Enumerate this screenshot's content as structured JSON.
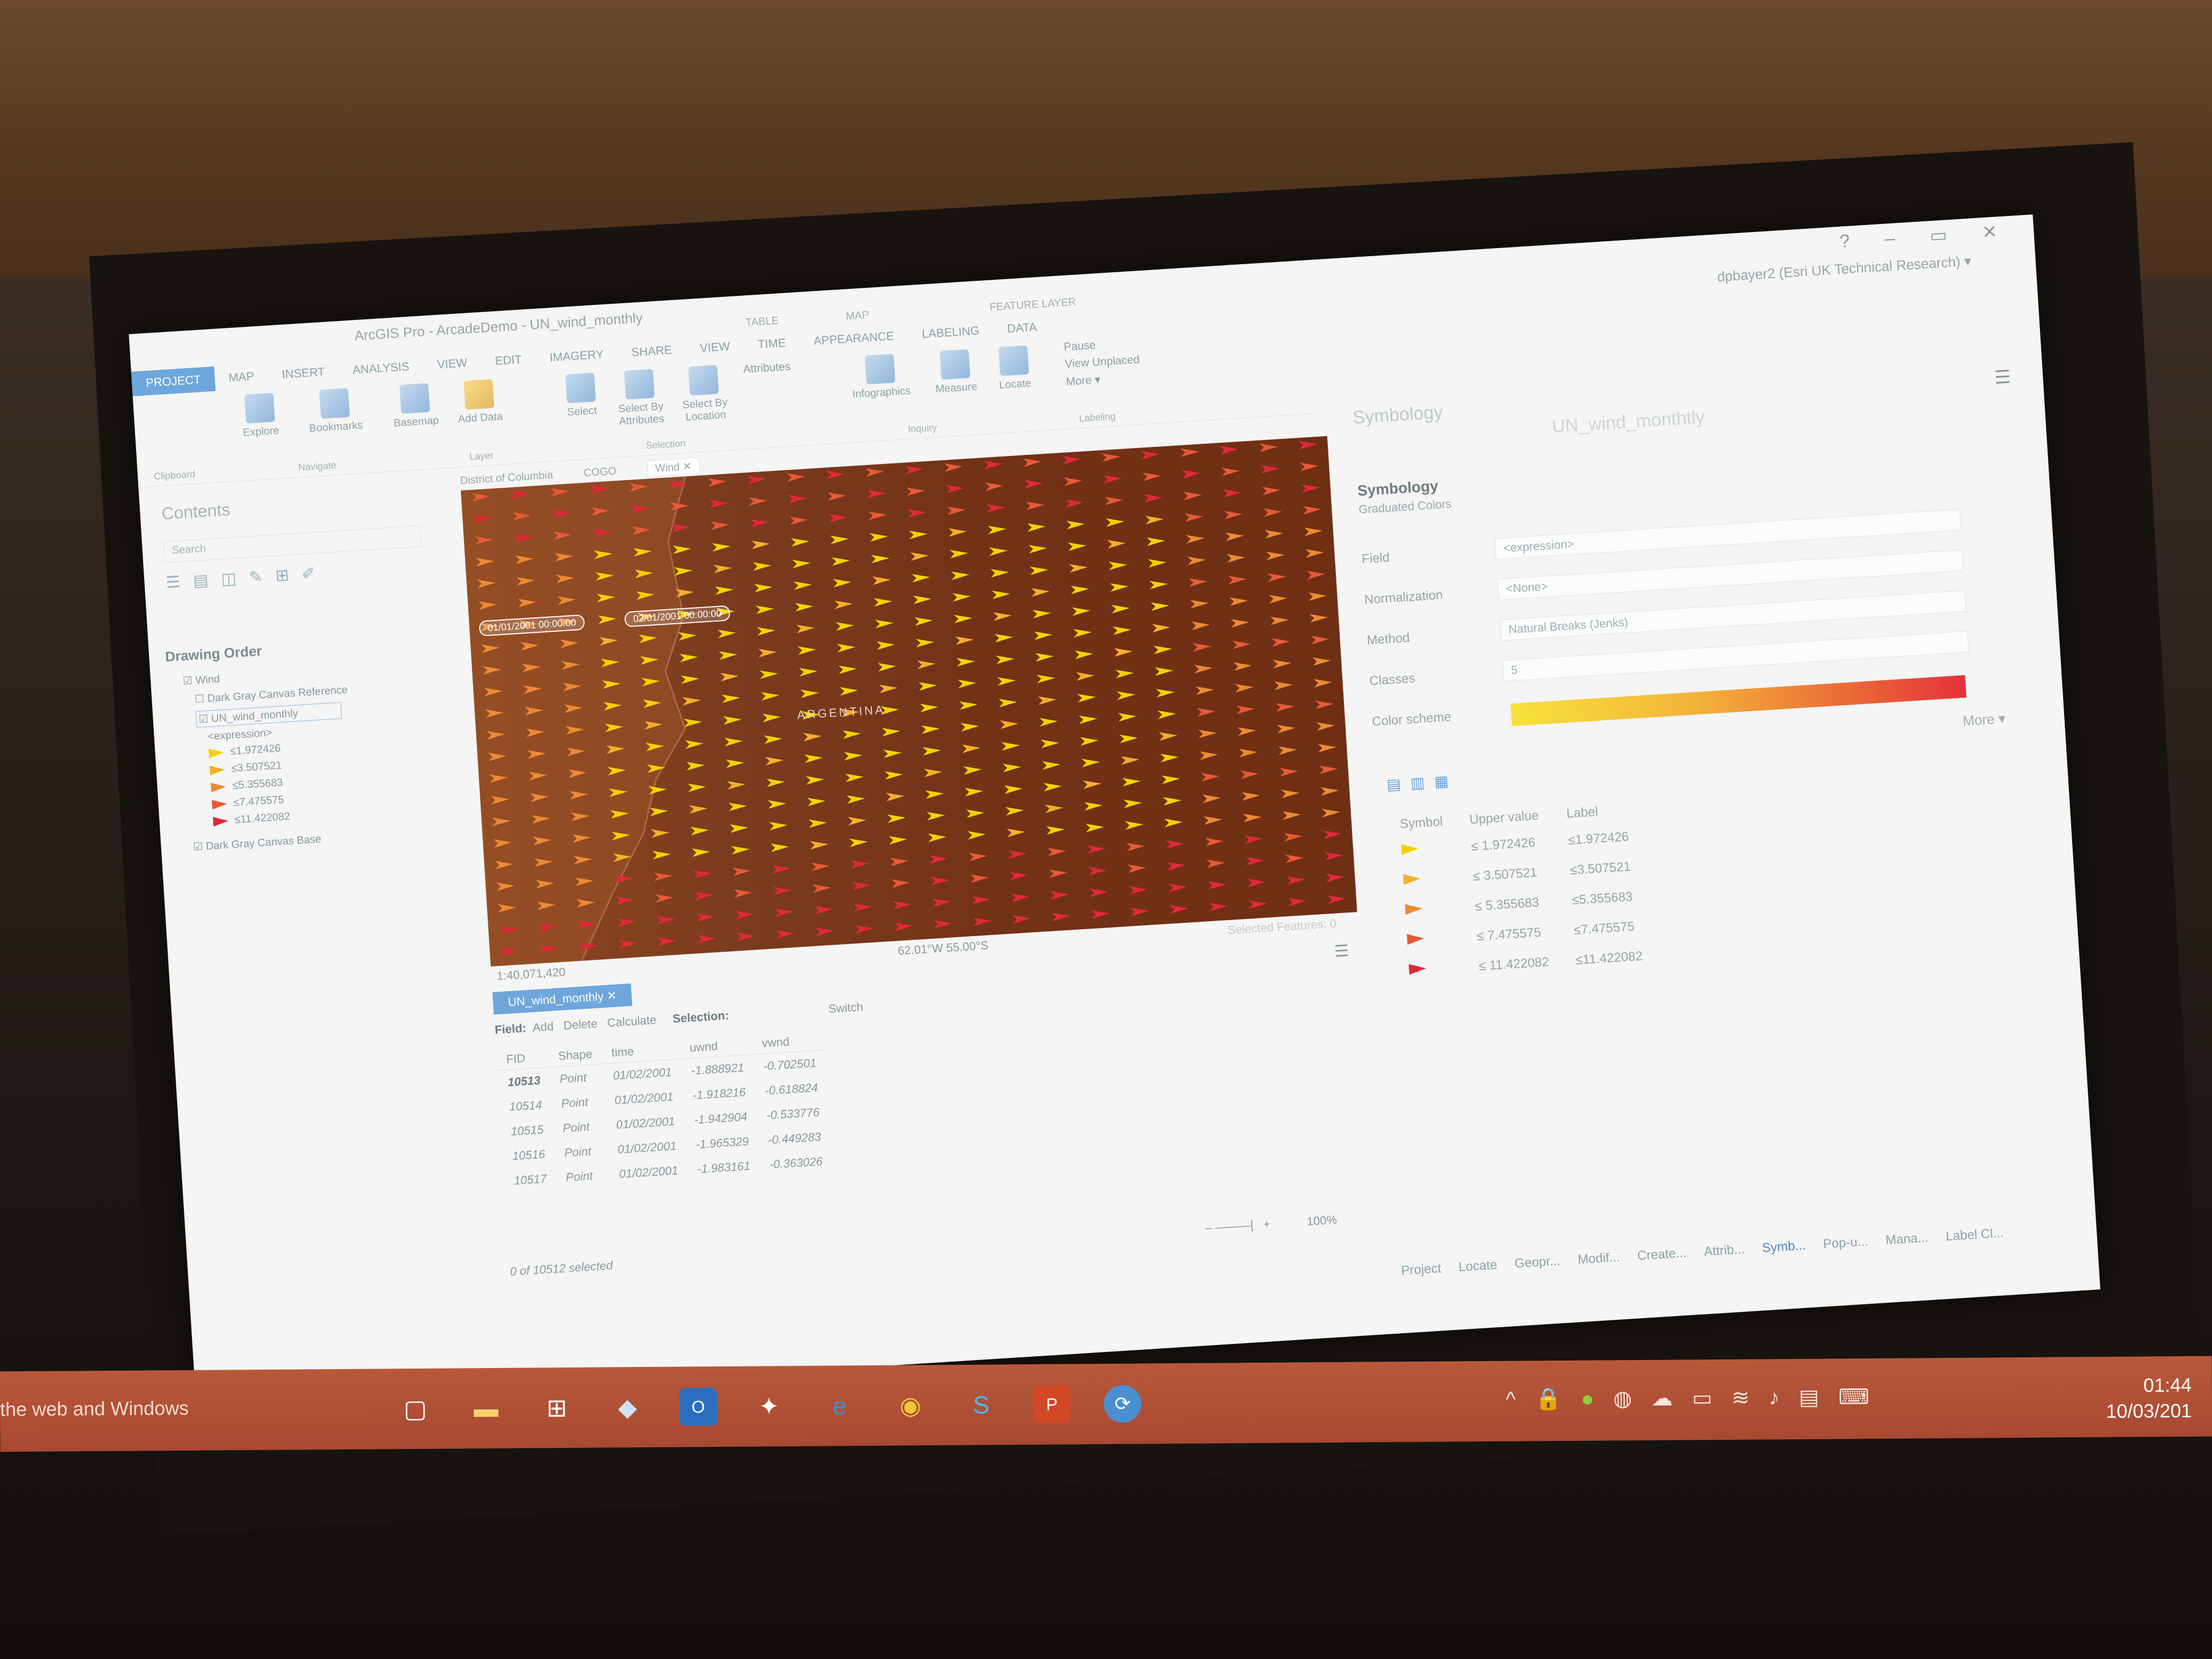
{
  "app": {
    "title": "ArcGIS Pro - ArcadeDemo - UN_wind_monthly",
    "window_controls": "? – ▭ ✕",
    "user": "dpbayer2 (Esri UK Technical Research) ▾"
  },
  "ribbon": {
    "context_headers": [
      "TABLE",
      "MAP",
      "FEATURE LAYER"
    ],
    "tabs": [
      "PROJECT",
      "MAP",
      "INSERT",
      "ANALYSIS",
      "VIEW",
      "EDIT",
      "IMAGERY",
      "SHARE",
      "VIEW",
      "TIME",
      "APPEARANCE",
      "LABELING",
      "DATA"
    ],
    "active_tab": "PROJECT",
    "buttons": {
      "explore": "Explore",
      "bookmarks": "Bookmarks",
      "basemap": "Basemap",
      "add_data": "Add Data",
      "select": "Select",
      "select_by_attributes": "Select By Attributes",
      "select_by_location": "Select By Location",
      "attributes": "Attributes",
      "infographics": "Infographics",
      "measure": "Measure",
      "locate": "Locate",
      "pause": "Pause",
      "view_unplaced": "View Unplaced",
      "more": "More ▾"
    },
    "groups": {
      "clipboard": "Clipboard",
      "navigate": "Navigate",
      "layer": "Layer",
      "selection": "Selection",
      "inquiry": "Inquiry",
      "labeling": "Labeling"
    }
  },
  "contents": {
    "title": "Contents",
    "search_placeholder": "Search",
    "drawing_order": "Drawing Order",
    "layers": {
      "wind": "Wind",
      "dark_gray_reference": "Dark Gray Canvas Reference",
      "un_wind": "UN_wind_monthly",
      "expression": "<expression>",
      "dark_gray_base": "Dark Gray Canvas Base"
    },
    "legend": [
      "≤1.972426",
      "≤3.507521",
      "≤5.355683",
      "≤7.475575",
      "≤11.422082"
    ]
  },
  "map": {
    "tabs": [
      "District of Columbia",
      "COGO",
      "Wind"
    ],
    "time_start": "01/01/2001 00:00:00",
    "time_end": "02/01/2001 00:00:00",
    "country_label": "ARGENTINA",
    "scale": "1:40,071,420",
    "coordinates": "62.01°W 55.00°S",
    "selected_features": "Selected Features: 0"
  },
  "table": {
    "tab_label": "UN_wind_monthly",
    "field_label": "Field:",
    "add": "Add",
    "delete": "Delete",
    "calculate": "Calculate",
    "selection_label": "Selection:",
    "switch": "Switch",
    "columns": [
      "FID",
      "Shape",
      "time",
      "uwnd",
      "vwnd"
    ],
    "rows": [
      [
        "10513",
        "Point",
        "01/02/2001",
        "-1.888921",
        "-0.702501"
      ],
      [
        "10514",
        "Point",
        "01/02/2001",
        "-1.918216",
        "-0.618824"
      ],
      [
        "10515",
        "Point",
        "01/02/2001",
        "-1.942904",
        "-0.533776"
      ],
      [
        "10516",
        "Point",
        "01/02/2001",
        "-1.965329",
        "-0.449283"
      ],
      [
        "10517",
        "Point",
        "01/02/2001",
        "-1.983161",
        "-0.363026"
      ]
    ],
    "status": "0 of 10512 selected",
    "zoom": "100%"
  },
  "symbology": {
    "pane_title": "Symbology",
    "layer_name": "UN_wind_monthtly",
    "heading": "Symbology",
    "renderer": "Graduated Colors",
    "field_label": "Field",
    "field_value": "<expression>",
    "normalization_label": "Normalization",
    "normalization_value": "<None>",
    "method_label": "Method",
    "method_value": "Natural Breaks (Jenks)",
    "classes_label": "Classes",
    "classes_value": "5",
    "color_scheme_label": "Color scheme",
    "more": "More ▾",
    "table_headers": [
      "Symbol",
      "Upper value",
      "Label"
    ],
    "classes": [
      {
        "upper": "1.972426",
        "label": "≤1.972426",
        "color": "#f5d100"
      },
      {
        "upper": "3.507521",
        "label": "≤3.507521",
        "color": "#f2b02a"
      },
      {
        "upper": "5.355683",
        "label": "≤5.355683",
        "color": "#ee8a33"
      },
      {
        "upper": "7.475575",
        "label": "≤7.475575",
        "color": "#e85a35"
      },
      {
        "upper": "11.422082",
        "label": "≤11.422082",
        "color": "#e2283b"
      }
    ]
  },
  "pane_tabs": [
    "Project",
    "Locate",
    "Geopr...",
    "Modif...",
    "Create...",
    "Attrib...",
    "Symb...",
    "Pop-u...",
    "Mana...",
    "Label Cl..."
  ],
  "active_pane_tab": "Symb...",
  "taskbar": {
    "search_text": "the web and Windows",
    "time": "01:44",
    "date": "10/03/201"
  }
}
